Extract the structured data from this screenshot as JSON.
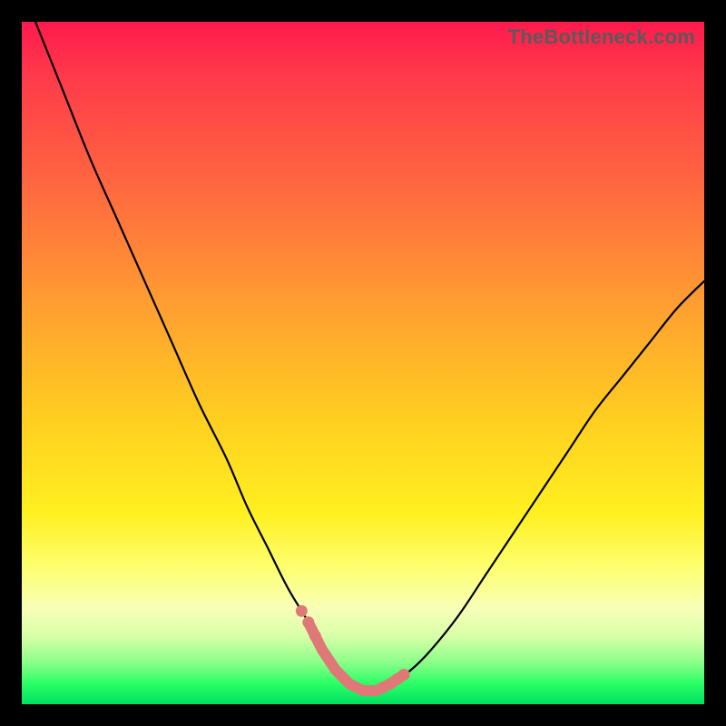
{
  "watermark": "TheBottleneck.com",
  "chart_data": {
    "type": "line",
    "title": "",
    "xlabel": "",
    "ylabel": "",
    "xlim": [
      0,
      100
    ],
    "ylim": [
      0,
      100
    ],
    "grid": false,
    "legend": false,
    "series": [
      {
        "name": "curve",
        "x": [
          2,
          6,
          10,
          14,
          18,
          22,
          26,
          30,
          33,
          36,
          39,
          42,
          44,
          46,
          48,
          50,
          52,
          54,
          57,
          60,
          64,
          68,
          72,
          76,
          80,
          84,
          88,
          92,
          96,
          100
        ],
        "y": [
          100,
          90,
          80,
          71,
          62,
          53,
          44,
          36,
          29,
          23,
          17,
          12,
          8,
          5,
          3,
          2,
          2,
          3,
          5,
          8,
          13,
          19,
          25,
          31,
          37,
          43,
          48,
          53,
          58,
          62
        ]
      }
    ],
    "highlight_range_x": [
      42,
      56
    ],
    "highlight_dots_x": [
      41,
      42,
      43,
      53,
      54,
      55,
      56
    ],
    "gradient": {
      "top": "#ff1a4d",
      "bottom": "#00e060"
    }
  }
}
